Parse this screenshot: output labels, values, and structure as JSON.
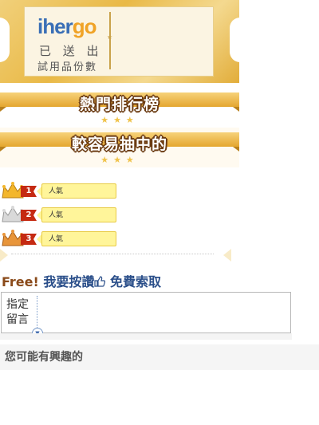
{
  "ticket": {
    "logo_part1": "iher",
    "logo_part2": "go",
    "sent_text": "已 送 出",
    "trial_text": "試用品份數"
  },
  "banners": [
    {
      "title": "熱門排行榜",
      "stars": "★★★"
    },
    {
      "title": "較容易抽中的",
      "stars": "★★★"
    }
  ],
  "ranking": [
    {
      "rank": "1",
      "label": "人氣",
      "crown": "gold"
    },
    {
      "rank": "2",
      "label": "人氣",
      "crown": "silver"
    },
    {
      "rank": "3",
      "label": "人氣",
      "crown": "bronze"
    }
  ],
  "cta": {
    "free": "Free!",
    "press": "我要按讚",
    "request": "免費索取"
  },
  "message": {
    "label": "指定留言",
    "toggle_icon": "chevron-down-icon"
  },
  "interest": {
    "title": "您可能有興趣的"
  },
  "colors": {
    "gold": "#e9b947",
    "brown": "#6b3b12",
    "blue": "#2b4f8a",
    "rank_red": "#c52a12",
    "label_yellow": "#fff59a"
  }
}
